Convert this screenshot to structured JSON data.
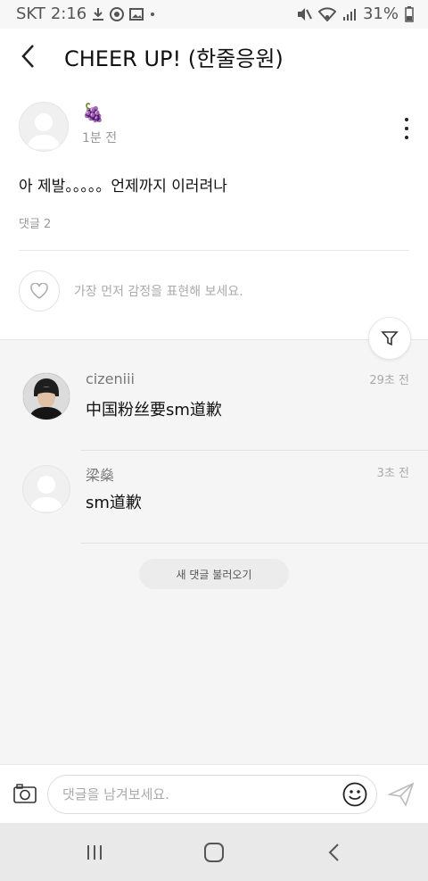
{
  "status_bar": {
    "carrier": "SKT",
    "time": "2:16",
    "battery": "31%",
    "icons_left": [
      "download-icon",
      "chrome-icon",
      "image-icon",
      "dot-icon"
    ],
    "icons_right": [
      "mute-icon",
      "wifi-icon",
      "signal-icon",
      "battery-icon"
    ]
  },
  "header": {
    "title": "CHEER UP! (한줄응원)"
  },
  "post": {
    "author_emoji": "🍇",
    "time": "1분 전",
    "body": "아 제발。。。。。언제까지 이러려나",
    "comment_count": "댓글 2",
    "emotion_prompt": "가장 먼저 감정을 표현해 보세요."
  },
  "comments": [
    {
      "name": "cizeniii",
      "time": "29초 전",
      "text": "中国粉丝要sm道歉"
    },
    {
      "name": "梁燊",
      "time": "3초 전",
      "text": "sm道歉"
    }
  ],
  "load_more_label": "새 댓글 불러오기",
  "input": {
    "placeholder": "댓글을 남겨보세요."
  },
  "colors": {
    "header_bg": "#ffffff",
    "comments_bg": "#f5f5f5",
    "nav_bg": "#e9e9e9",
    "muted_text": "#999999"
  }
}
